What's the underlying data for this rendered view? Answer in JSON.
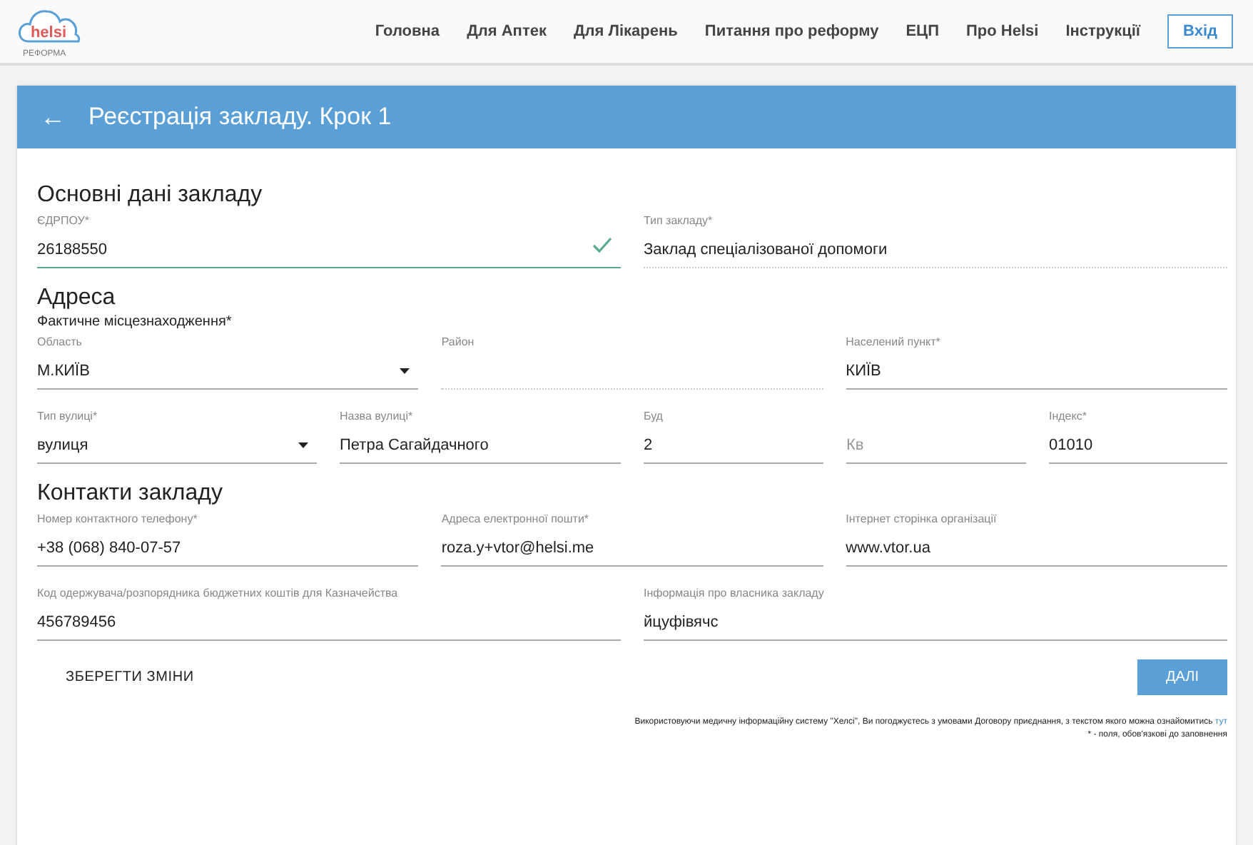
{
  "header": {
    "logo": {
      "name": "helsi",
      "subtitle": "РЕФОРМА"
    },
    "nav": [
      {
        "label": "Головна"
      },
      {
        "label": "Для Аптек"
      },
      {
        "label": "Для Лікарень"
      },
      {
        "label": "Питання про реформу"
      },
      {
        "label": "ЕЦП"
      },
      {
        "label": "Про Helsi"
      },
      {
        "label": "Інструкції"
      }
    ],
    "login": "Вхід"
  },
  "page": {
    "back": "←",
    "title": "Реєстрація закладу. Крок 1"
  },
  "sections": [
    {
      "title": "Основні дані закладу",
      "rows": [
        {
          "kind": "half",
          "fields": [
            {
              "label": "ЄДРПОУ*",
              "value": "26188550",
              "kind": "text",
              "valid": true
            },
            {
              "label": "Тип закладу*",
              "value": "Заклад спеціалізованої допомоги",
              "kind": "readonly",
              "valid": false
            }
          ]
        }
      ]
    },
    {
      "title": "Адреса",
      "subtitle": "Фактичне місцезнаходження*",
      "rows": [
        {
          "kind": "third",
          "fields": [
            {
              "label": "Область",
              "value": "М.КИЇВ",
              "kind": "select",
              "valid": false
            },
            {
              "label": "Район",
              "kind": "readonly",
              "valid": false
            },
            {
              "label": "Населений пункт*",
              "value": "КИЇВ",
              "kind": "text",
              "valid": false
            }
          ]
        },
        {
          "kind": "street",
          "fields": [
            {
              "label": "Тип вулиці*",
              "value": "вулиця",
              "kind": "select",
              "valid": false
            },
            {
              "label": "Назва вулиці*",
              "value": "Петра Сагайдачного",
              "kind": "text",
              "valid": false
            },
            {
              "label": "Буд",
              "value": "2",
              "kind": "text",
              "valid": false
            },
            {
              "placeholder": "Кв",
              "kind": "text",
              "valid": false
            },
            {
              "label": "Індекс*",
              "value": "01010",
              "kind": "text",
              "valid": false
            }
          ]
        }
      ]
    },
    {
      "title": "Контакти закладу",
      "rows": [
        {
          "kind": "third",
          "fields": [
            {
              "label": "Номер контактного телефону*",
              "value": "+38 (068) 840-07-57",
              "kind": "text",
              "valid": false
            },
            {
              "label": "Адреса електронної пошти*",
              "value": "roza.y+vtor@helsi.me",
              "kind": "text",
              "valid": false
            },
            {
              "label": "Інтернет сторінка організації",
              "value": "www.vtor.ua",
              "kind": "text",
              "valid": false
            }
          ]
        },
        {
          "kind": "half",
          "fields": [
            {
              "label": "Код одержувача/розпорядника бюджетних коштів для Казначейства",
              "value": "456789456",
              "kind": "text",
              "valid": false
            },
            {
              "label": "Інформація про власника закладу",
              "value": "йцуфівячс",
              "kind": "text",
              "valid": false
            }
          ]
        }
      ]
    }
  ],
  "actions": {
    "save": "ЗБЕРЕГТИ ЗМІНИ",
    "next": "ДАЛІ"
  },
  "footer": {
    "agreement": "Використовуючи медичну інформаційну систему \"Хелсі\", Ви погоджуєтесь з умовами Договору приєднання, з текстом якого можна ознайомитись",
    "link": "тут",
    "note": "* - поля, обов'язкові до заповнення"
  }
}
